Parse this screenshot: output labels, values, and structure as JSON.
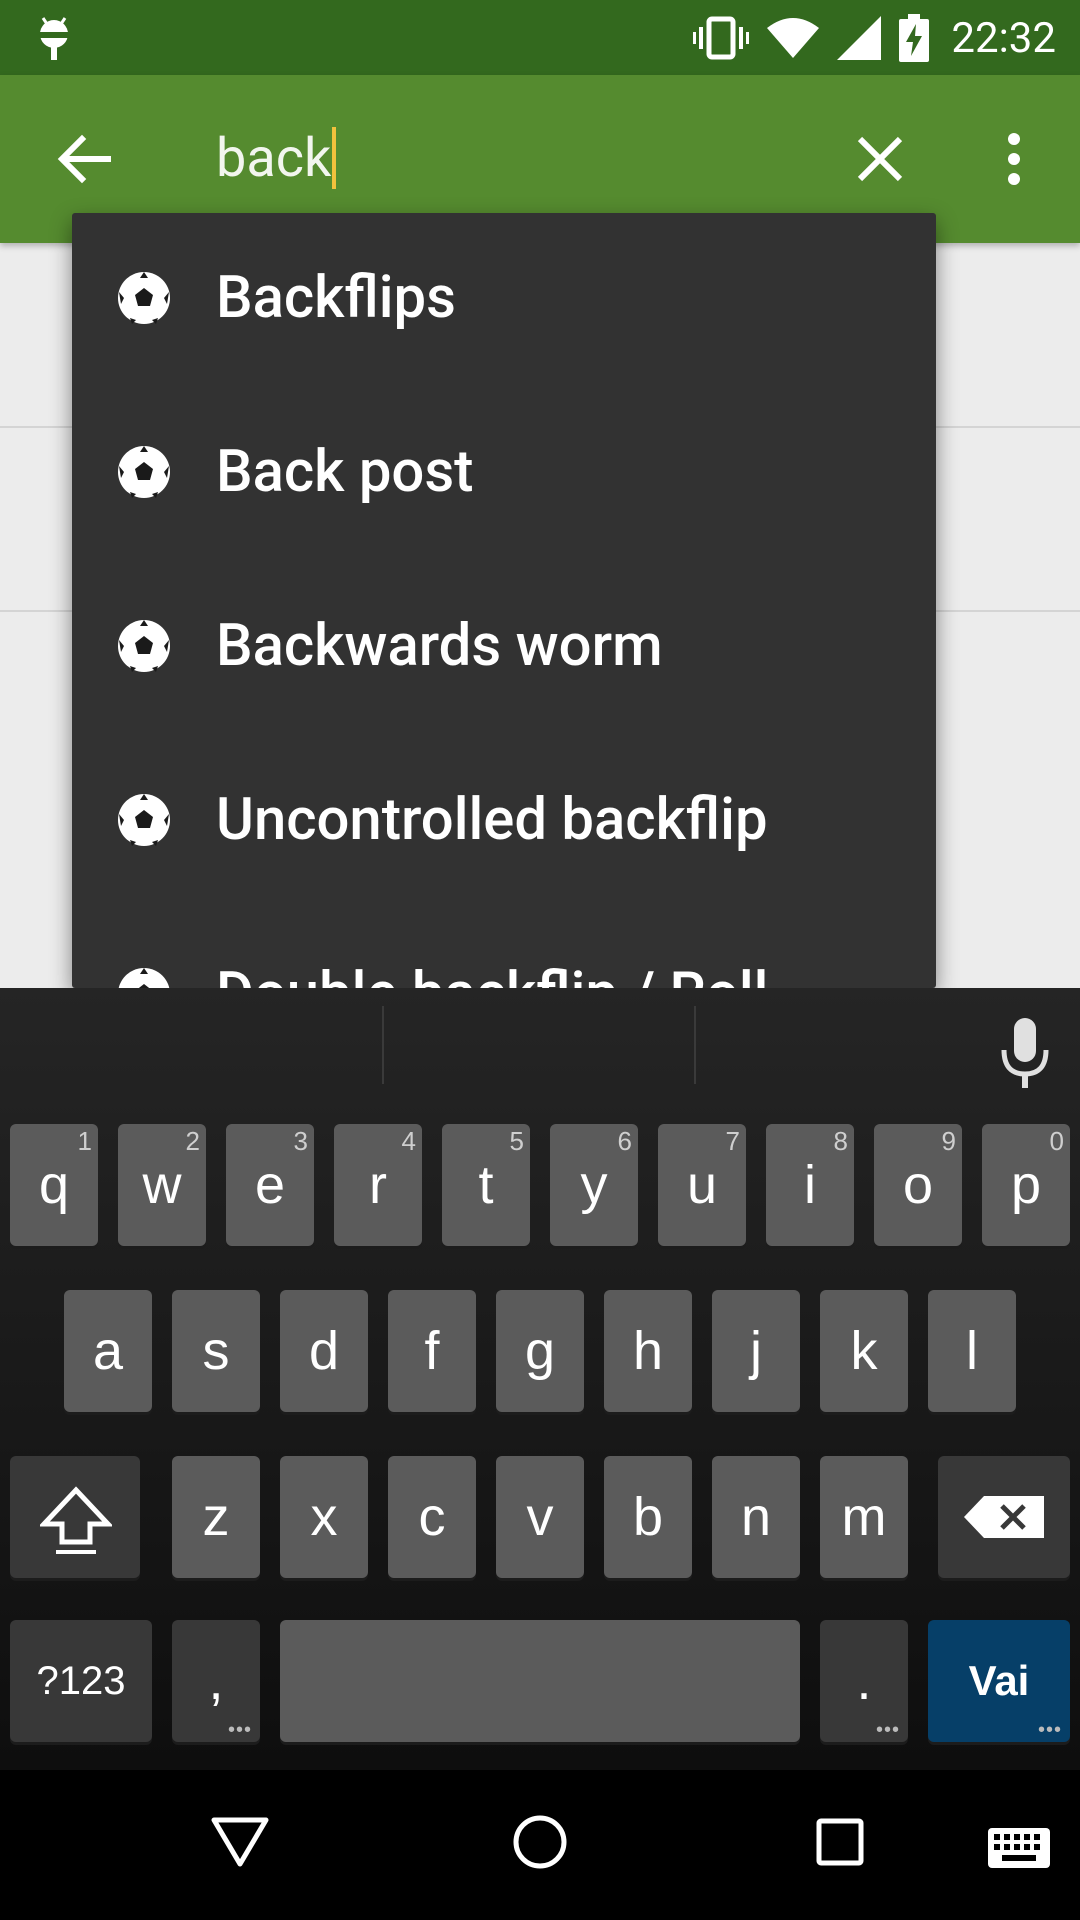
{
  "status_bar": {
    "time": "22:32",
    "icons": [
      "android-debug-icon",
      "vibrate-icon",
      "wifi-icon",
      "cell-signal-icon",
      "battery-charging-icon"
    ]
  },
  "app_bar": {
    "search_query": "back",
    "icons": [
      "back-arrow-icon",
      "clear-icon",
      "more-vert-icon"
    ],
    "colors": {
      "status_bar": "#33691e",
      "toolbar": "#558b2f",
      "cursor": "#f2c13d"
    }
  },
  "suggestions": [
    {
      "label": "Backflips",
      "icon": "soccer-ball-icon"
    },
    {
      "label": "Back post",
      "icon": "soccer-ball-icon"
    },
    {
      "label": "Backwards worm",
      "icon": "soccer-ball-icon"
    },
    {
      "label": "Uncontrolled backflip",
      "icon": "soccer-ball-icon"
    },
    {
      "label": "Double backflip / Roll",
      "icon": "soccer-ball-icon"
    }
  ],
  "keyboard": {
    "row1": [
      {
        "key": "q",
        "hint": "1"
      },
      {
        "key": "w",
        "hint": "2"
      },
      {
        "key": "e",
        "hint": "3"
      },
      {
        "key": "r",
        "hint": "4"
      },
      {
        "key": "t",
        "hint": "5"
      },
      {
        "key": "y",
        "hint": "6"
      },
      {
        "key": "u",
        "hint": "7"
      },
      {
        "key": "i",
        "hint": "8"
      },
      {
        "key": "o",
        "hint": "9"
      },
      {
        "key": "p",
        "hint": "0"
      }
    ],
    "row2": [
      "a",
      "s",
      "d",
      "f",
      "g",
      "h",
      "j",
      "k",
      "l"
    ],
    "row3": [
      "z",
      "x",
      "c",
      "v",
      "b",
      "n",
      "m"
    ],
    "symbols_label": "?123",
    "comma_label": ",",
    "period_label": ".",
    "action_label": "Vai",
    "icons": [
      "microphone-icon",
      "shift-icon",
      "backspace-icon"
    ],
    "colors": {
      "key": "#5b5b5b",
      "key_dark": "#383838",
      "action": "#063f68"
    }
  },
  "nav_bar": {
    "icons": [
      "nav-back-icon",
      "nav-home-icon",
      "nav-recents-icon",
      "keyboard-switch-icon"
    ]
  }
}
